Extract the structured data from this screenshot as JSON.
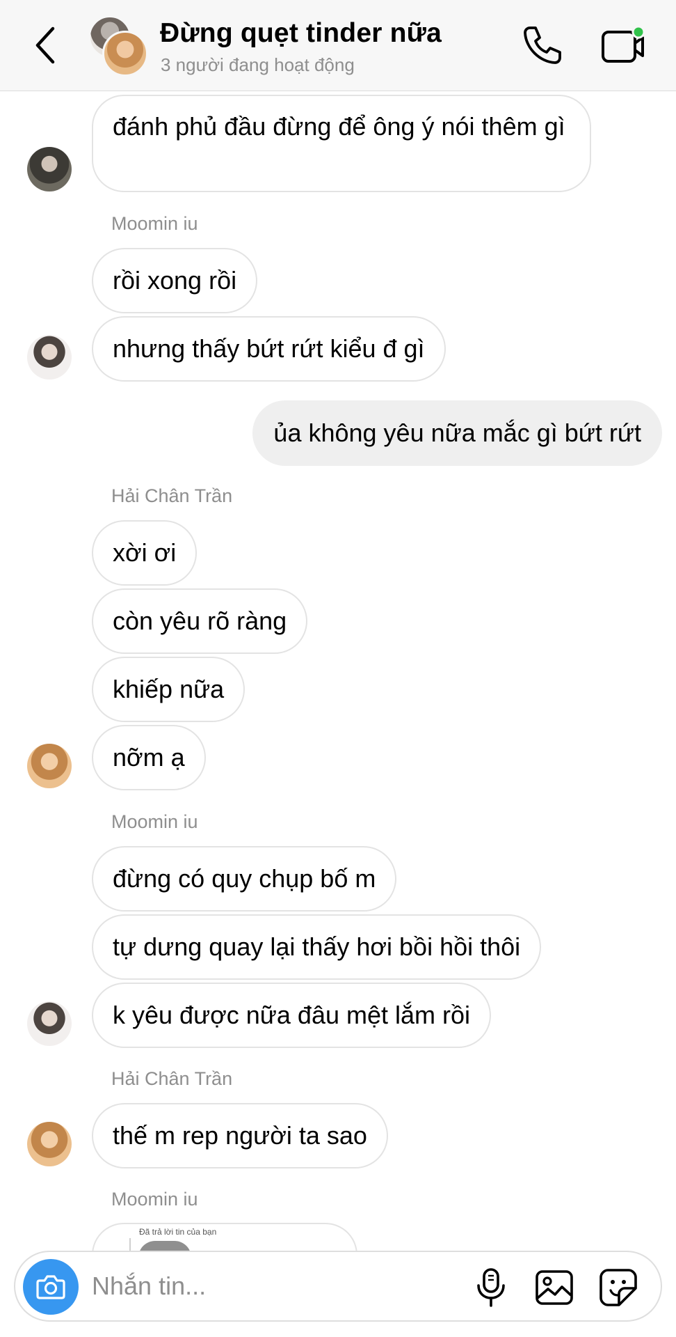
{
  "header": {
    "title": "Đừng quẹt tinder nữa",
    "subtitle": "3 người đang hoạt động",
    "icons": [
      "back-icon",
      "group-avatar",
      "phone-icon",
      "video-camera-icon"
    ],
    "active_dot_color": "#31c24b"
  },
  "messages": {
    "m1": "đánh phủ đầu đừng để ông ý nói thêm gì",
    "sender_1": "Moomin iu",
    "m2": "rồi xong rồi",
    "m3": "nhưng thấy bứt rứt kiểu đ gì",
    "m4": "ủa không yêu nữa mắc gì bứt rứt",
    "sender_2": "Hải Chân Trần",
    "m5": "xời ơi",
    "m6": "còn yêu rõ ràng",
    "m7": "khiếp nữa",
    "m8": "nỡm ạ",
    "sender_3": "Moomin iu",
    "m9": "đừng có quy chụp bố m",
    "m10": "tự dưng quay lại thấy hơi bồi hồi thôi",
    "m11": "k yêu được nữa đâu mệt lắm rồi",
    "sender_4": "Hải Chân Trần",
    "m12": "thế m rep người ta sao",
    "sender_5": "Moomin iu",
    "reply_label": "Đã trả lời tin của bạn"
  },
  "composer": {
    "placeholder": "Nhắn tin...",
    "icons": [
      "camera-icon",
      "microphone-icon",
      "gallery-icon",
      "sticker-icon"
    ],
    "camera_color": "#3797f0"
  }
}
